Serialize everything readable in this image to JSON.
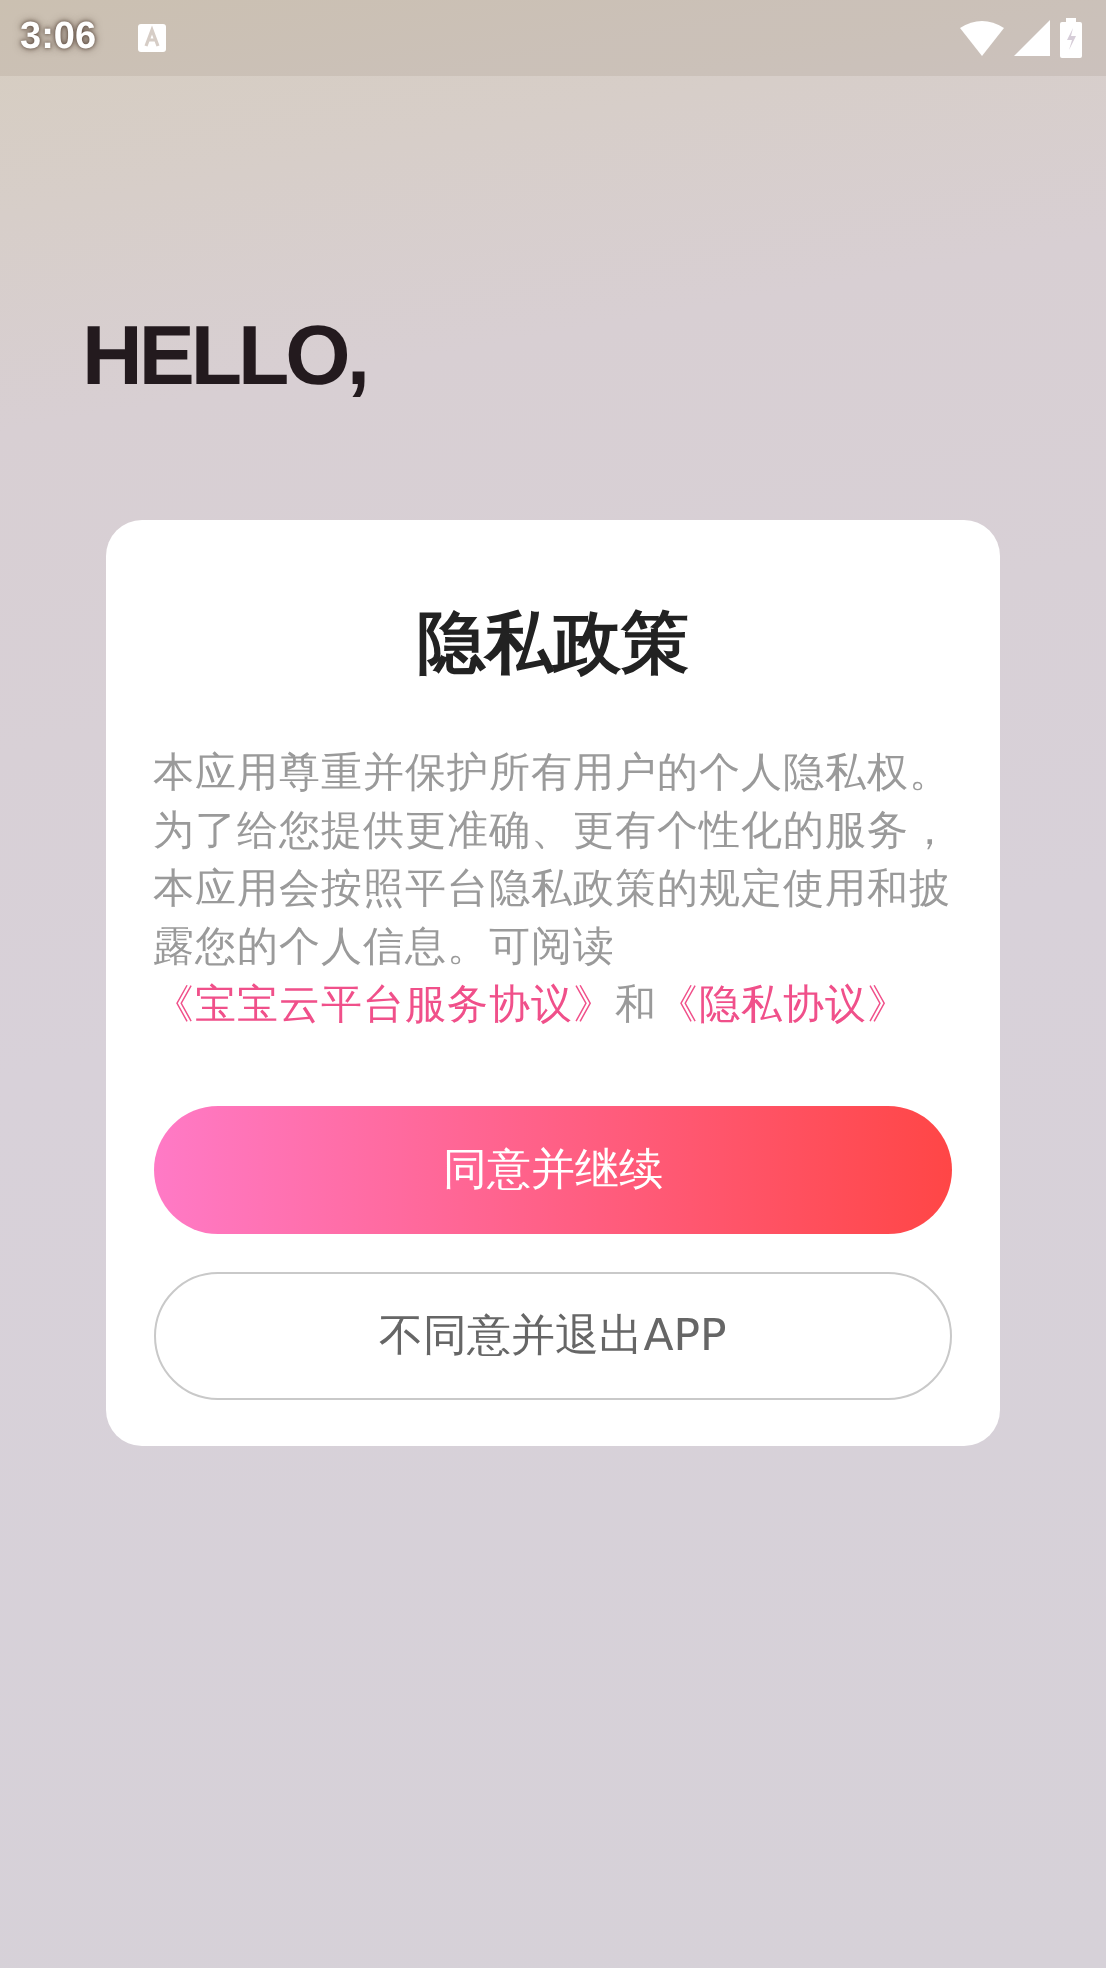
{
  "status_bar": {
    "time": "3:06"
  },
  "greeting": "HELLO,",
  "dialog": {
    "title": "隐私政策",
    "body": "本应用尊重并保护所有用户的个人隐私权。为了给您提供更准确、更有个性化的服务，本应用会按照平台隐私政策的规定使用和披露您的个人信息。可阅读",
    "links": [
      "《宝宝云平台服务协议》",
      "《隐私协议》"
    ],
    "joiner": "和",
    "buttons": [
      {
        "label": "同意并继续",
        "kind": "primary"
      },
      {
        "label": "不同意并退出APP",
        "kind": "secondary"
      }
    ]
  }
}
